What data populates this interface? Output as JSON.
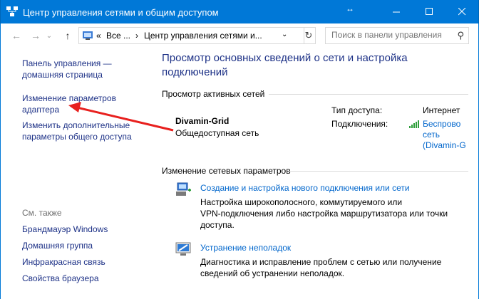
{
  "window": {
    "title": "Центр управления сетями и общим доступом",
    "resize_glyph": "↔",
    "minimize_glyph": "—",
    "maximize_glyph": "☐",
    "close_glyph": "✕"
  },
  "nav": {
    "back": "←",
    "forward": "→",
    "chevron": "⌄",
    "up": "↑",
    "address_prefix": "«",
    "address_parts": [
      "Все ...",
      "›",
      "Центр управления сетями и...",
      "⌄"
    ],
    "refresh": "↻",
    "search_placeholder": "Поиск в панели управления",
    "search_icon": "⚲"
  },
  "sidebar": {
    "home_link_1": "Панель управления —",
    "home_link_2": "домашняя страница",
    "adapter_1": "Изменение параметров",
    "adapter_2": "адаптера",
    "advanced_1": "Изменить дополнительные",
    "advanced_2": "параметры общего доступа",
    "see_also": "См. также",
    "see_also_items": [
      "Брандмауэр Windows",
      "Домашняя группа",
      "Инфракрасная связь",
      "Свойства браузера"
    ]
  },
  "main": {
    "heading_1": "Просмотр основных сведений о сети и настройка",
    "heading_2": "подключений",
    "active_networks": "Просмотр активных сетей",
    "network_name": "Divamin-Grid",
    "network_type": "Общедоступная сеть",
    "access_type_label": "Тип доступа:",
    "access_type_value": "Интернет",
    "connections_label": "Подключения:",
    "connection_1": "Беспрово",
    "connection_2": "сеть",
    "connection_3": "(Divamin-G",
    "change_settings": "Изменение сетевых параметров",
    "new_connection_link": "Создание и настройка нового подключения или сети",
    "new_connection_desc_1": "Настройка широкополосного, коммутируемого или",
    "new_connection_desc_2": "VPN-подключения либо настройка маршрутизатора или точки",
    "new_connection_desc_3": "доступа.",
    "troubleshoot_link": "Устранение неполадок",
    "troubleshoot_desc_1": "Диагностика и исправление проблем с сетью или получение",
    "troubleshoot_desc_2": "сведений об устранении неполадок."
  },
  "colors": {
    "titlebar": "#0078d7",
    "link": "#1e3287",
    "action_link": "#0066cc",
    "annotation_arrow": "#e8201e"
  }
}
